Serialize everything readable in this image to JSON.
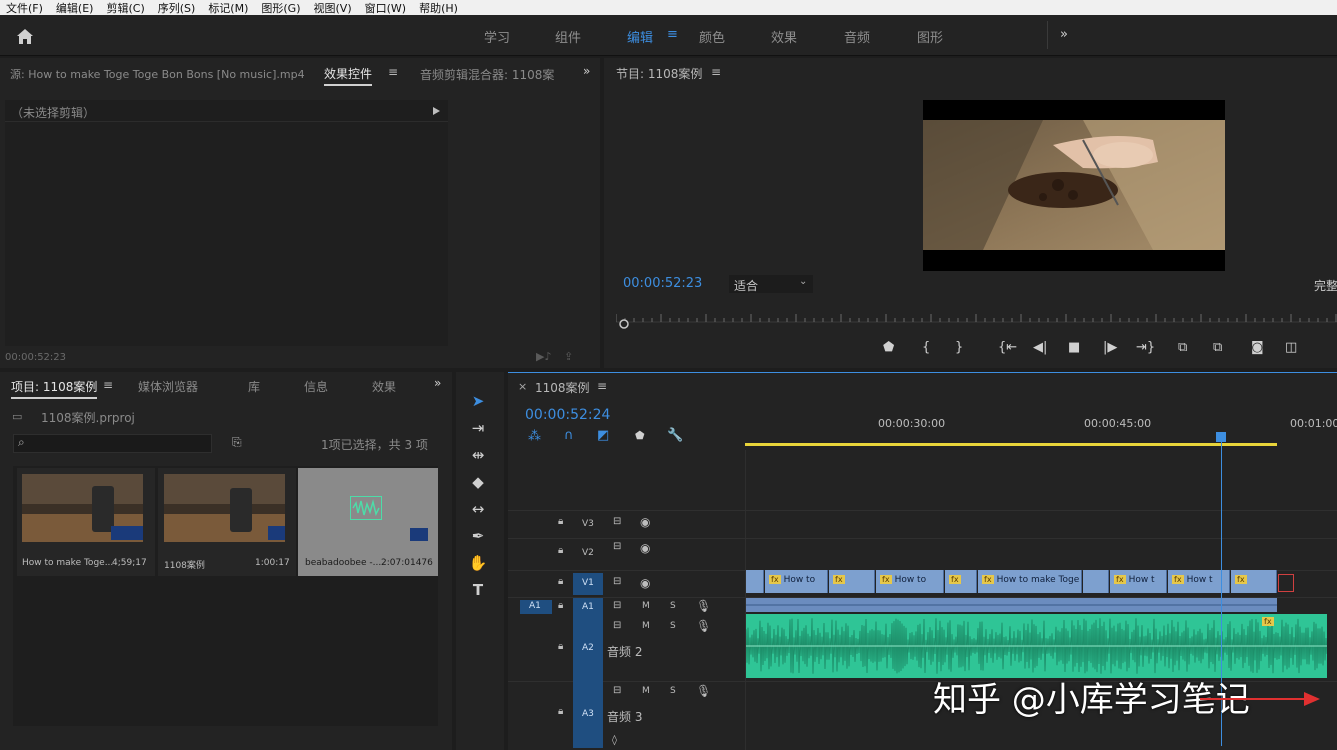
{
  "menu": [
    "文件(F)",
    "编辑(E)",
    "剪辑(C)",
    "序列(S)",
    "标记(M)",
    "图形(G)",
    "视图(V)",
    "窗口(W)",
    "帮助(H)"
  ],
  "workspaces": {
    "learn": "学习",
    "assembly": "组件",
    "editing": "编辑",
    "color": "颜色",
    "effects": "效果",
    "audio": "音频",
    "graphics": "图形",
    "more": "»"
  },
  "source_panel": {
    "source_tab": "源: How to make Toge Toge Bon Bons [No music].mp4",
    "effect_controls_tab": "效果控件",
    "audio_mixer_tab": "音频剪辑混合器: 1108案",
    "no_clip": "（未选择剪辑）",
    "timecode": "00:00:52:23"
  },
  "program_monitor": {
    "title": "节目: 1108案例",
    "timecode": "00:00:52:23",
    "fit": "适合",
    "quality": "完整"
  },
  "project_panel": {
    "tabs": [
      "项目: 1108案例",
      "媒体浏览器",
      "库",
      "信息",
      "效果"
    ],
    "project_file": "1108案例.prproj",
    "selection_status": "1项已选择，共 3 项",
    "items": [
      {
        "name": "How to make Toge...",
        "duration": "4;59;17"
      },
      {
        "name": "1108案例",
        "duration": "1:00:17"
      },
      {
        "name": "beabadoobee -...",
        "duration": "2:07:01476"
      }
    ]
  },
  "timeline": {
    "title": "1108案例",
    "timecode": "00:00:52:24",
    "ruler": [
      "00:00:30:00",
      "00:00:45:00",
      "00:01:00"
    ],
    "tracks": {
      "v3": "V3",
      "v2": "V2",
      "v1": "V1",
      "a1_src": "A1",
      "a1": "A1",
      "a2": "A2",
      "a2_name": "音频 2",
      "a3": "A3",
      "a3_name": "音频 3",
      "m": "M",
      "s": "S"
    },
    "clips": [
      "How to",
      "How to",
      "How to make Toge",
      "How t",
      "How t"
    ]
  },
  "watermark": "知乎 @小库学习笔记",
  "colors": {
    "accent": "#3d8ee0",
    "video_clip": "#7da0cf",
    "audio_clip": "#2fc596",
    "playhead": "#3d8ee0",
    "work_area": "#e8d43a"
  }
}
